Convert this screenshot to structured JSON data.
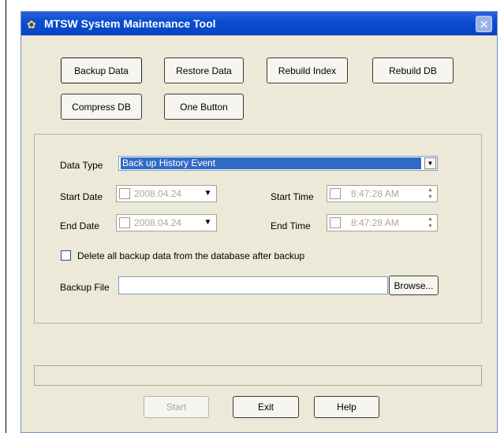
{
  "window": {
    "title": "MTSW System Maintenance Tool"
  },
  "buttons": {
    "backup": "Backup Data",
    "restore": "Restore Data",
    "rebuild_index": "Rebuild Index",
    "rebuild_db": "Rebuild DB",
    "compress": "Compress DB",
    "one_button": "One Button"
  },
  "form": {
    "data_type_label": "Data Type",
    "data_type_value": "Back up History Event",
    "start_date_label": "Start Date",
    "start_date_value": "2008.04.24",
    "end_date_label": "End Date",
    "end_date_value": "2008.04.24",
    "start_time_label": "Start Time",
    "start_time_value": "8:47:28 AM",
    "end_time_label": "End Time",
    "end_time_value": "8:47:28 AM",
    "delete_checkbox_label": "Delete all backup data from the database after backup",
    "backup_file_label": "Backup File",
    "backup_file_value": "",
    "browse_label": "Browse..."
  },
  "footer": {
    "start": "Start",
    "exit": "Exit",
    "help": "Help"
  },
  "icons": {
    "app": "app-icon",
    "close": "close-icon"
  },
  "colors": {
    "titlebar": "#0a4ed2",
    "window_bg": "#ece9d8",
    "selection": "#316ac5"
  }
}
